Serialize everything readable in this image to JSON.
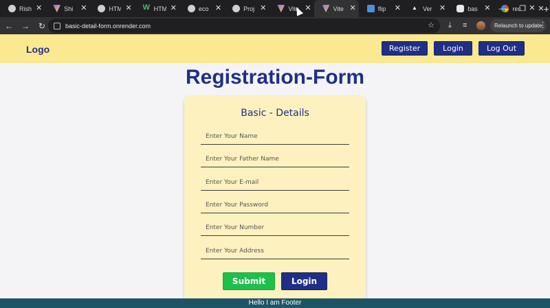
{
  "browser": {
    "tabs": [
      {
        "title": "Rish",
        "icon": "github-icon"
      },
      {
        "title": "Shi",
        "icon": "vite-icon"
      },
      {
        "title": "HTM",
        "icon": "globe-icon"
      },
      {
        "title": "HTM",
        "icon": "w-icon"
      },
      {
        "title": "eco",
        "icon": "github-icon"
      },
      {
        "title": "Proj",
        "icon": "github-icon"
      },
      {
        "title": "Vite",
        "icon": "vite-icon"
      },
      {
        "title": "Vite",
        "icon": "vite-icon",
        "active": true
      },
      {
        "title": "flip",
        "icon": "flipkart-icon"
      },
      {
        "title": "Ver",
        "icon": "vercel-icon"
      },
      {
        "title": "bas",
        "icon": "render-icon"
      },
      {
        "title": "rec",
        "icon": "google-icon"
      }
    ],
    "url": "basic-detail-form.onrender.com",
    "relaunch_label": "Relaunch to update"
  },
  "header": {
    "logo": "Logo",
    "register_label": "Register",
    "login_label": "Login",
    "logout_label": "Log Out"
  },
  "main": {
    "title": "Registration-Form",
    "card_title": "Basic - Details",
    "fields": [
      {
        "placeholder": "Enter Your Name"
      },
      {
        "placeholder": "Enter Your Father Name"
      },
      {
        "placeholder": "Enter Your E-mail"
      },
      {
        "placeholder": "Enter Your Password"
      },
      {
        "placeholder": "Enter Your Number"
      },
      {
        "placeholder": "Enter Your Address"
      }
    ],
    "submit_label": "Submit",
    "login_label": "Login"
  },
  "footer": {
    "text": "Hello I am Footer"
  },
  "colors": {
    "accent": "#1f2f86",
    "header_bg": "#fbe992",
    "card_bg": "#fdf2bf",
    "submit": "#1fbf4c",
    "footer_bg": "#1e5566"
  }
}
